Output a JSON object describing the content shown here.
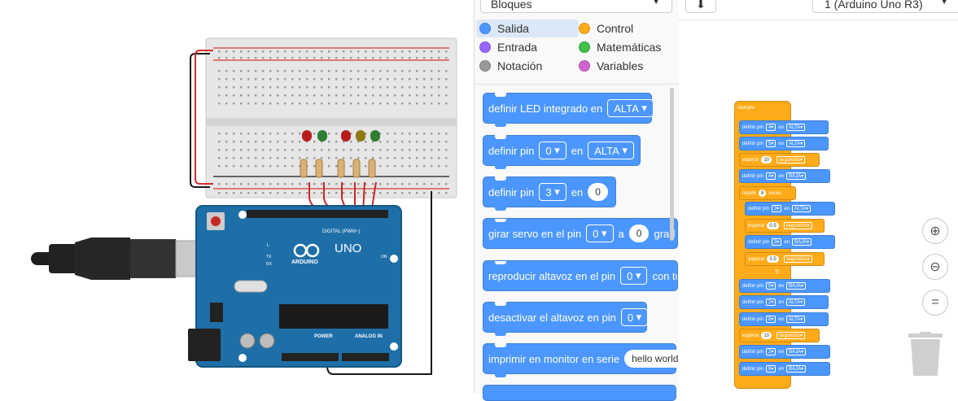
{
  "palette": {
    "dropdown_label": "Bloques",
    "categories": [
      {
        "label": "Salida",
        "color": "#4c97ff"
      },
      {
        "label": "Control",
        "color": "#ffab19"
      },
      {
        "label": "Entrada",
        "color": "#9966ff"
      },
      {
        "label": "Matemáticas",
        "color": "#40bf4a"
      },
      {
        "label": "Notación",
        "color": "#999999"
      },
      {
        "label": "Variables",
        "color": "#cf63cf"
      }
    ],
    "blocks": [
      {
        "text": "definir LED integrado en",
        "value": "ALTA"
      },
      {
        "text": "definir pin",
        "pin": "0",
        "mid": "en",
        "value": "ALTA"
      },
      {
        "text": "definir pin",
        "pin": "3",
        "mid": "en",
        "value": "0"
      },
      {
        "text": "girar servo en el pin",
        "pin": "0",
        "mid": "a",
        "value": "0",
        "tail": "grad"
      },
      {
        "text": "reproducir altavoz en el pin",
        "pin": "0",
        "tail": "con ton"
      },
      {
        "text": "desactivar el altavoz en pin",
        "pin": "0"
      },
      {
        "text": "imprimir en monitor en serie",
        "value": "hello world"
      }
    ]
  },
  "header": {
    "board_label": "1 (Arduino Uno R3)"
  },
  "arduino": {
    "logo": "ARDUINO",
    "model": "UNO",
    "digital_label": "DIGITAL (PWM~)",
    "power_label": "POWER",
    "analog_label": "ANALOG IN",
    "on_label": "ON",
    "tx_label": "TX",
    "rx_label": "RX",
    "l_label": "L"
  },
  "code": {
    "hat": "siempre",
    "blocks": [
      {
        "kind": "blue",
        "text": "definir pin",
        "pin": "4",
        "mid": "en",
        "value": "ALTA"
      },
      {
        "kind": "blue",
        "text": "definir pin",
        "pin": "5",
        "mid": "en",
        "value": "ALTA"
      },
      {
        "kind": "or",
        "text": "esperar",
        "pin": "10",
        "mid": "segundos"
      },
      {
        "kind": "blue",
        "text": "definir pin",
        "pin": "4",
        "mid": "en",
        "value": "BAJA"
      },
      {
        "kind": "or",
        "text": "repetir",
        "pin": "8",
        "mid": "veces"
      },
      {
        "kind": "blue",
        "text": "definir pin",
        "pin": "3",
        "mid": "en",
        "value": "ALTA"
      },
      {
        "kind": "or",
        "text": "esperar",
        "pin": "0.5",
        "mid": "segundos"
      },
      {
        "kind": "blue",
        "text": "definir pin",
        "pin": "3",
        "mid": "en",
        "value": "BAJA"
      },
      {
        "kind": "or",
        "text": "esperar",
        "pin": "0.5",
        "mid": "segundos"
      },
      {
        "kind": "blue",
        "text": "definir pin",
        "pin": "5",
        "mid": "en",
        "value": "BAJA"
      },
      {
        "kind": "blue",
        "text": "definir pin",
        "pin": "2",
        "mid": "en",
        "value": "ALTA"
      },
      {
        "kind": "blue",
        "text": "definir pin",
        "pin": "6",
        "mid": "en",
        "value": "ALTA"
      },
      {
        "kind": "or",
        "text": "esperar",
        "pin": "10",
        "mid": "segundos"
      },
      {
        "kind": "blue",
        "text": "definir pin",
        "pin": "2",
        "mid": "en",
        "value": "BAJA"
      },
      {
        "kind": "blue",
        "text": "definir pin",
        "pin": "6",
        "mid": "en",
        "value": "BAJA"
      }
    ]
  },
  "zoom": {
    "in_icon": "zoom-in-icon",
    "out_icon": "zoom-out-icon",
    "fit_icon": "fit-icon",
    "trash_icon": "trash-icon"
  }
}
